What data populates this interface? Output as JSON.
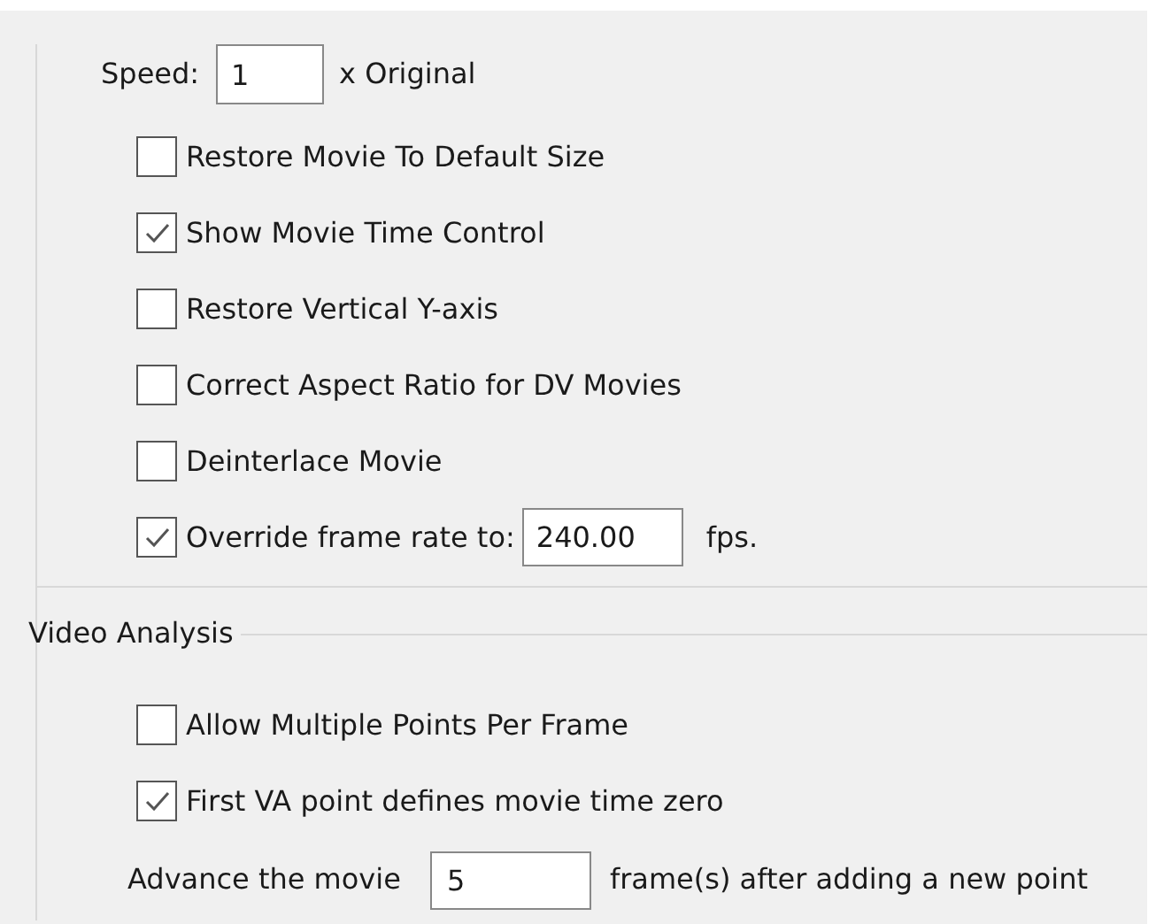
{
  "speed": {
    "label": "Speed:",
    "value": "1",
    "suffix": "x Original"
  },
  "options": [
    {
      "label": "Restore Movie To Default Size",
      "checked": false
    },
    {
      "label": "Show Movie Time Control",
      "checked": true
    },
    {
      "label": "Restore Vertical Y-axis",
      "checked": false
    },
    {
      "label": "Correct Aspect Ratio for DV Movies",
      "checked": false
    },
    {
      "label": "Deinterlace Movie",
      "checked": false
    },
    {
      "label": "Override frame rate to:",
      "checked": true,
      "value": "240.00",
      "suffix": "fps."
    }
  ],
  "video_analysis": {
    "title": "Video Analysis",
    "options": [
      {
        "label": "Allow Multiple Points Per Frame",
        "checked": false
      },
      {
        "label": "First VA point defines movie time zero",
        "checked": true
      }
    ],
    "advance": {
      "label": "Advance the movie",
      "value": "5",
      "suffix": "frame(s) after adding a new point"
    }
  }
}
